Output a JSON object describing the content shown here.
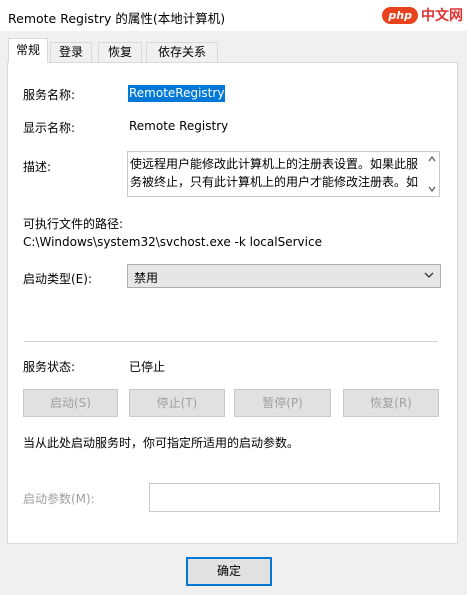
{
  "window": {
    "title": "Remote Registry 的属性(本地计算机)",
    "watermark_logo": "php",
    "watermark_text": "中文网"
  },
  "tabs": [
    {
      "label": "常规",
      "active": true
    },
    {
      "label": "登录",
      "active": false
    },
    {
      "label": "恢复",
      "active": false
    },
    {
      "label": "依存关系",
      "active": false
    }
  ],
  "general": {
    "service_name_label": "服务名称:",
    "service_name_value": "RemoteRegistry",
    "display_name_label": "显示名称:",
    "display_name_value": "Remote Registry",
    "description_label": "描述:",
    "description_value": "使远程用户能修改此计算机上的注册表设置。如果此服务被终止，只有此计算机上的用户才能修改注册表。如",
    "path_label": "可执行文件的路径:",
    "path_value": "C:\\Windows\\system32\\svchost.exe -k localService",
    "startup_type_label": "启动类型(E):",
    "startup_type_value": "禁用",
    "status_label": "服务状态:",
    "status_value": "已停止",
    "buttons": {
      "start": "启动(S)",
      "stop": "停止(T)",
      "pause": "暂停(P)",
      "resume": "恢复(R)"
    },
    "hint_text": "当从此处启动服务时，你可指定所适用的启动参数。",
    "start_params_label": "启动参数(M):",
    "start_params_value": ""
  },
  "footer": {
    "ok_label": "确定"
  },
  "colors": {
    "accent": "#0078d7",
    "window_bg": "#f0f0f0",
    "disabled_text": "#a0a0a0"
  }
}
